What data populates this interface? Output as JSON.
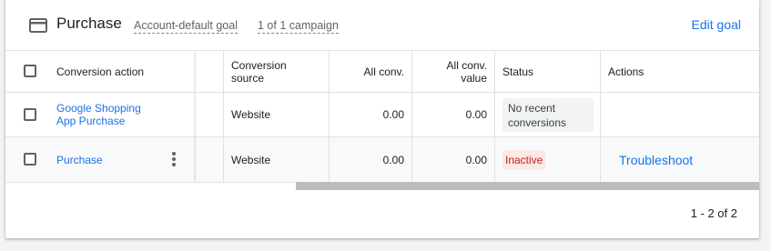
{
  "header": {
    "title": "Purchase",
    "goal_type": "Account-default goal",
    "campaigns": "1 of 1 campaign",
    "edit_goal": "Edit goal",
    "icon": "goal-card-icon"
  },
  "table": {
    "columns": [
      "Conversion action",
      "Conversion source",
      "All conv.",
      "All conv. value",
      "Status",
      "Actions"
    ],
    "rows": [
      {
        "action": "Google Shopping App Purchase",
        "source": "Website",
        "all_conv": "0.00",
        "all_conv_value": "0.00",
        "status": "No recent conversions",
        "actions": ""
      },
      {
        "action": "Purchase",
        "source": "Website",
        "all_conv": "0.00",
        "all_conv_value": "0.00",
        "status": "Inactive",
        "actions": "Troubleshoot"
      }
    ]
  },
  "pagination": {
    "label": "1 - 2 of 2"
  },
  "colors": {
    "accent": "#1a73e8",
    "inactive_text": "#c5221f",
    "inactive_bg": "#fce8e6"
  }
}
